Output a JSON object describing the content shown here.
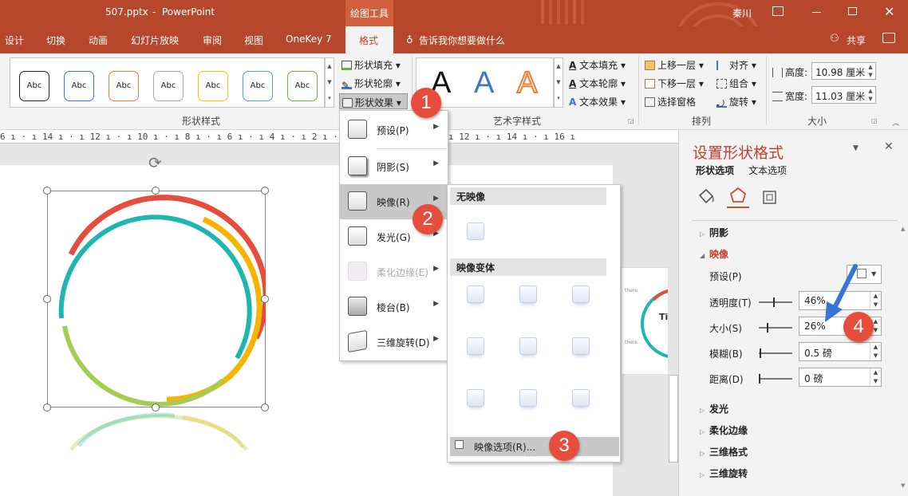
{
  "titlebar": {
    "filename": "507.pptx",
    "sep": "-",
    "app": "PowerPoint",
    "context_tab": "绘图工具",
    "user": "秦川",
    "ribbon_display_icon": "ribbon-display-icon",
    "min_icon": "minimize-icon",
    "max_icon": "restore-icon",
    "close_icon": "close-icon"
  },
  "tabs": [
    "设计",
    "切换",
    "动画",
    "幻灯片放映",
    "审阅",
    "视图",
    "OneKey 7",
    "格式"
  ],
  "active_tab": "格式",
  "tell_me": "告诉我你想要做什么",
  "share": "共享",
  "ribbon": {
    "shape_styles": {
      "label": "形状样式",
      "thumbs": [
        "Abc",
        "Abc",
        "Abc",
        "Abc",
        "Abc",
        "Abc",
        "Abc"
      ],
      "thumb_colors": [
        "#222222",
        "#4472c4",
        "#ed7d31",
        "#a5a5a5",
        "#ffc000",
        "#5b9bd5",
        "#70ad47"
      ]
    },
    "fill": "形状填充",
    "outline": "形状轮廓",
    "effects": "形状效果",
    "wordart": {
      "label": "艺术字样式",
      "letters": [
        "A",
        "A",
        "A"
      ],
      "text_fill": "文本填充",
      "text_outline": "文本轮廓",
      "text_effects": "文本效果"
    },
    "arrange": {
      "label": "排列",
      "bring_forward": "上移一层",
      "send_backward": "下移一层",
      "selection_pane": "选择窗格",
      "align": "对齐",
      "group": "组合",
      "rotate": "旋转"
    },
    "size": {
      "label": "大小",
      "height_label": "高度:",
      "height_value": "10.98 厘米",
      "width_label": "宽度:",
      "width_value": "11.03 厘米"
    }
  },
  "ruler": {
    "left": "6 ı · ı 14 ı · ı 12 ı · ı 10 ı · ı 8 ı · ı 6 ı · ı 4 ı · ı 2 ı · ı 0 ı · ı 2 ı",
    "right": "ı 12 ı · ı 14 ı · ı 16 ı"
  },
  "effects_menu": {
    "items": [
      {
        "label": "预设(P)",
        "enabled": true
      },
      {
        "label": "阴影(S)",
        "enabled": true
      },
      {
        "label": "映像(R)",
        "enabled": true
      },
      {
        "label": "发光(G)",
        "enabled": true
      },
      {
        "label": "柔化边缘(E)",
        "enabled": false
      },
      {
        "label": "棱台(B)",
        "enabled": true
      },
      {
        "label": "三维旋转(D)",
        "enabled": true
      }
    ]
  },
  "reflection_menu": {
    "no_reflection": "无映像",
    "variations": "映像变体",
    "options": "映像选项(R)...",
    "dots": "····"
  },
  "badges": [
    "1",
    "2",
    "3",
    "4"
  ],
  "pane": {
    "title": "设置形状格式",
    "tab_shape": "形状选项",
    "tab_text": "文本选项",
    "sections": {
      "shadow": "阴影",
      "reflection": "映像",
      "glow": "发光",
      "soft_edges": "柔化边缘",
      "format_3d": "三维格式",
      "rotation_3d": "三维旋转"
    },
    "reflection": {
      "presets": "预设(P)",
      "transparency_label": "透明度(T)",
      "transparency": "46%",
      "size_label": "大小(S)",
      "size": "26%",
      "blur_label": "模糊(B)",
      "blur": "0.5 磅",
      "distance_label": "距离(D)",
      "distance": "0 磅"
    }
  },
  "thumbnail_text": [
    "there.",
    "Ti",
    "there."
  ],
  "colors": {
    "accent": "#b7472a",
    "pane_title": "#c7402b",
    "badge": "#e84c3d",
    "ring_red": "#e84c3d",
    "ring_teal": "#1fb5b0",
    "ring_yellow": "#f7b500",
    "ring_green": "#a7cc52"
  }
}
